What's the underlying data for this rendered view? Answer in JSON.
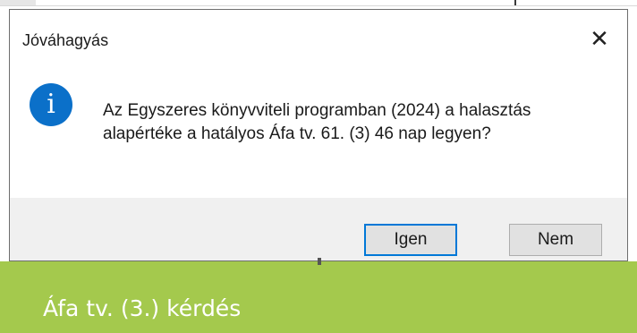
{
  "dialog": {
    "title": "Jóváhagyás",
    "close_label": "✕",
    "icon": "info-icon",
    "icon_glyph": "i",
    "message": "Az Egyszeres könyvviteli programban (2024) a halasztás alapértéke a hatályos Áfa tv. 61. (3) 46 nap legyen?",
    "buttons": {
      "yes": "Igen",
      "no": "Nem"
    }
  },
  "caption": {
    "text": "Áfa tv. (3.) kérdés",
    "background": "#a4c94d"
  },
  "colors": {
    "accent": "#0078d7",
    "info_icon": "#0b70c9"
  }
}
